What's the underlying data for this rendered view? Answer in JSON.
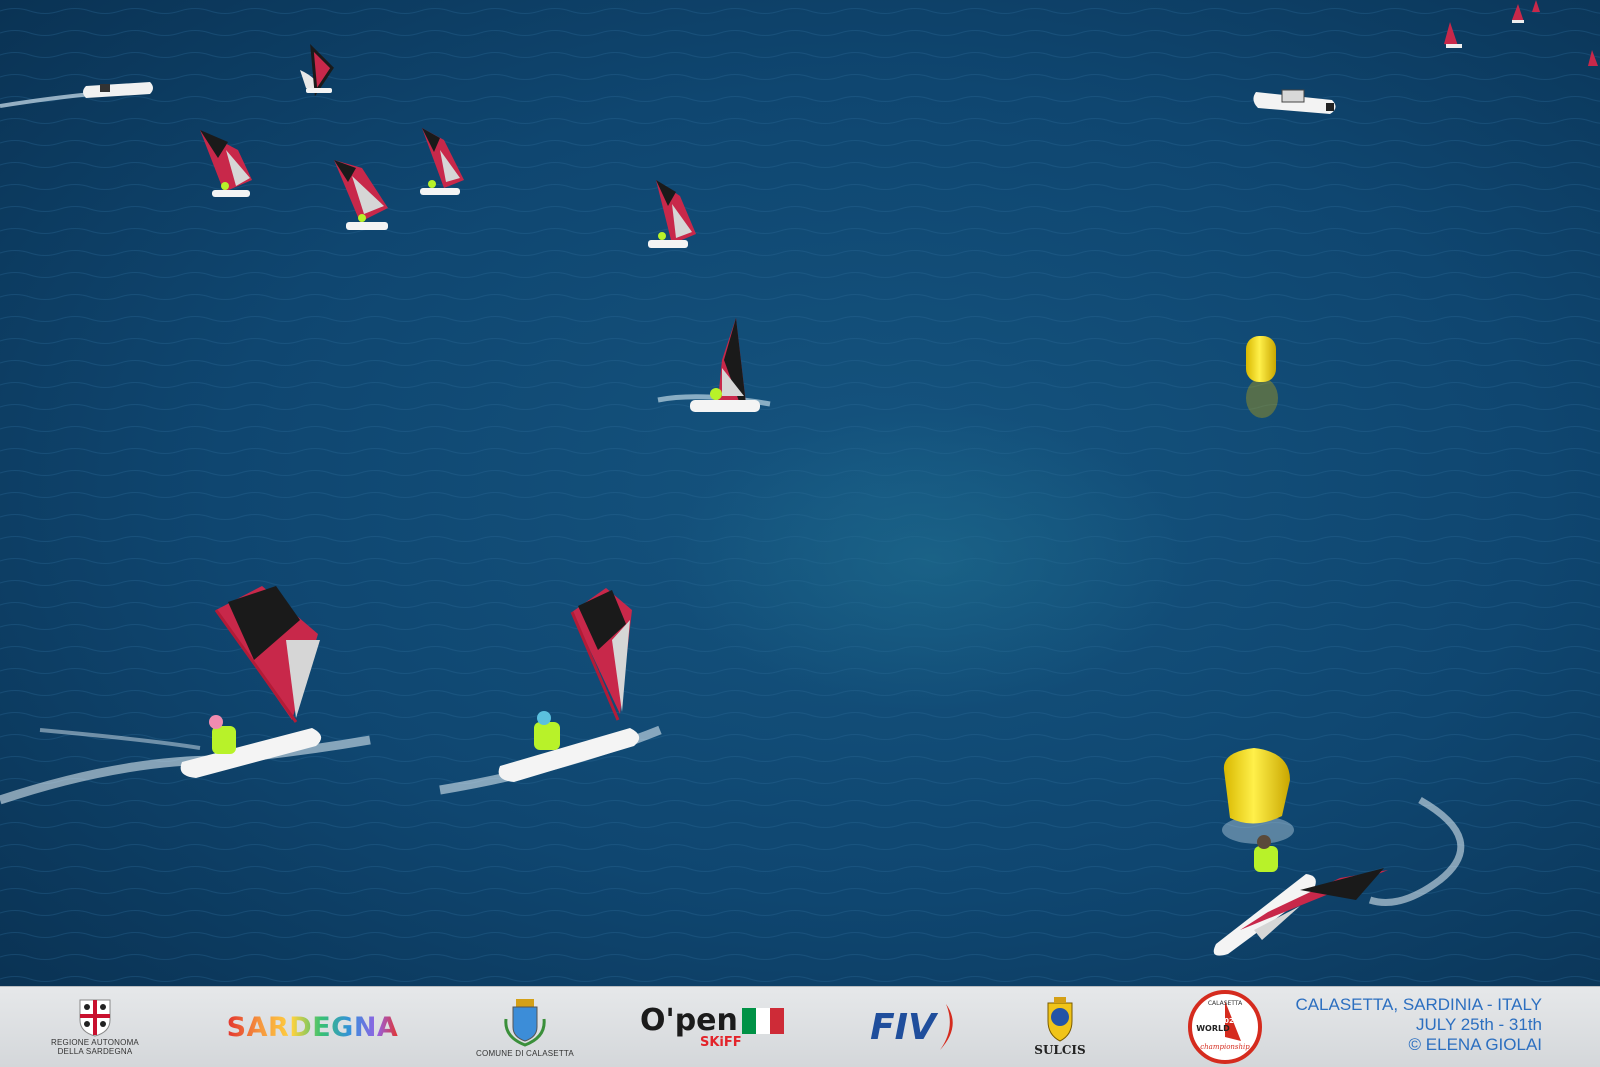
{
  "scene": {
    "sea_colors": [
      "#0b3a5f",
      "#14527f",
      "#0a3556"
    ],
    "sail_colors": [
      "#1a1a1a",
      "#c8284a",
      "#e8e8e8"
    ],
    "buoy_color": "#f2d616",
    "rash_vest_color": "#b8f229"
  },
  "sponsors": {
    "region_label_line1": "REGIONE AUTONOMA",
    "region_label_line2": "DELLA SARDEGNA",
    "sardegna": "SARDEGNA",
    "comune_label": "COMUNE DI CALASETTA",
    "open_word": "O'pen",
    "skiff_word": "SKiFF",
    "fiv": "FIV",
    "sulcis": "SULCIS",
    "badge_top": "CALASETTA",
    "badge_world": "WORLD",
    "badge_year": "2026",
    "badge_champ": "championship"
  },
  "event": {
    "line1": "CALASETTA, SARDINIA - ITALY",
    "line2": "JULY  25th - 31th",
    "line3": "© ELENA GIOLAI"
  }
}
